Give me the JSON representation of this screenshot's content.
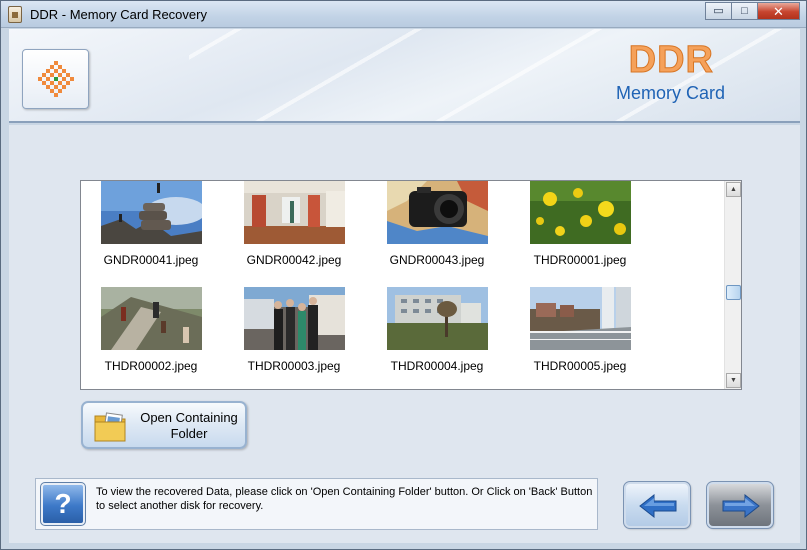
{
  "window": {
    "title": "DDR - Memory Card Recovery",
    "controls": {
      "minimize": "▭",
      "maximize": "□",
      "close": "✕"
    }
  },
  "header": {
    "brand": "DDR",
    "product": "Memory Card",
    "logo_icon": "checkered-diamond-icon",
    "brand_color": "#f5a15a",
    "product_color": "#1f63b5"
  },
  "gallery": {
    "items": [
      {
        "filename": "GNDR00041.jpeg",
        "icon": "photo-rocks-climbers"
      },
      {
        "filename": "GNDR00042.jpeg",
        "icon": "photo-hall-interior"
      },
      {
        "filename": "GNDR00043.jpeg",
        "icon": "photo-camera-maps"
      },
      {
        "filename": "THDR00001.jpeg",
        "icon": "photo-yellow-flowers"
      },
      {
        "filename": "THDR00002.jpeg",
        "icon": "photo-stairs-hikers"
      },
      {
        "filename": "THDR00003.jpeg",
        "icon": "photo-group-people"
      },
      {
        "filename": "THDR00004.jpeg",
        "icon": "photo-building-lawn"
      },
      {
        "filename": "THDR00005.jpeg",
        "icon": "photo-balcony-view"
      }
    ],
    "scroll_position": 0.55
  },
  "actions": {
    "open_folder_label_line1": "Open Containing",
    "open_folder_label_line2": "Folder",
    "help_glyph": "?",
    "info_text": "To view the recovered Data, please click on 'Open Containing Folder' button. Or Click on 'Back' Button to select another disk for recovery."
  },
  "nav": {
    "back_icon": "left-arrow-icon",
    "next_icon": "right-arrow-icon"
  }
}
